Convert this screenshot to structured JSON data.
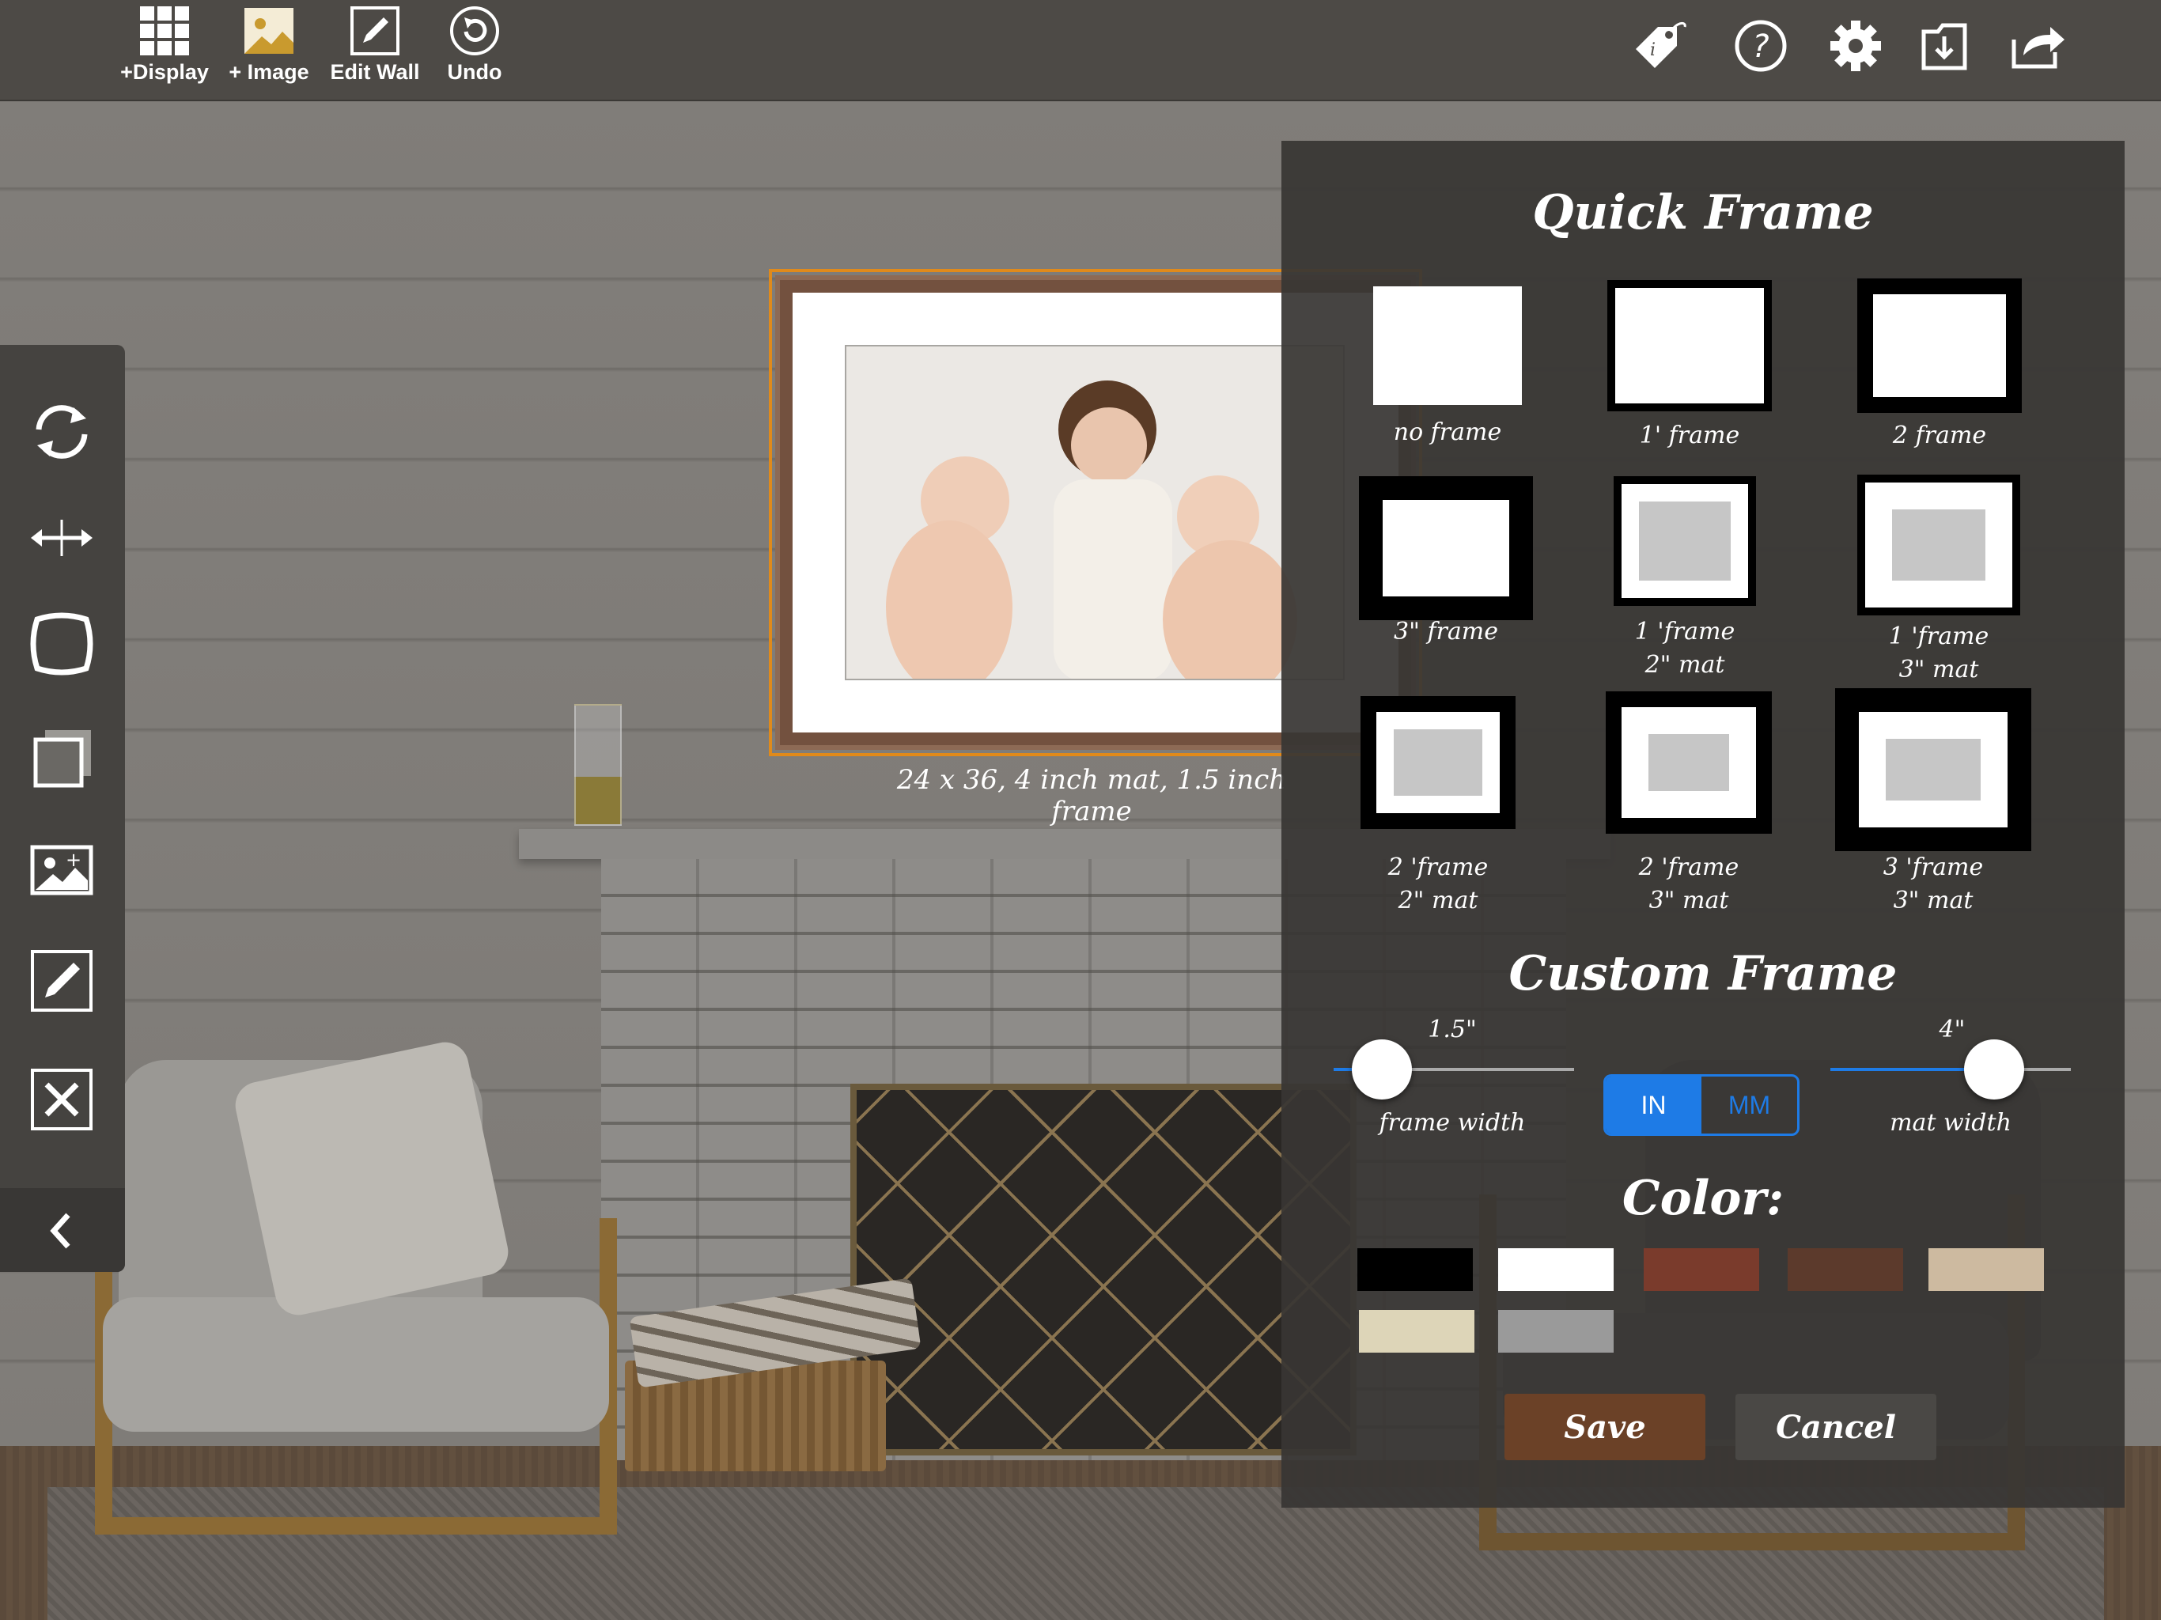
{
  "toolbar": {
    "display_label": "+Display",
    "image_label": "+ Image",
    "edit_wall_label": "Edit Wall",
    "undo_label": "Undo",
    "right_icons": [
      "info-tag-icon",
      "help-icon",
      "gear-icon",
      "save-to-folder-icon",
      "share-icon"
    ]
  },
  "rail": {
    "items": [
      "rotate-icon",
      "resize-horizontal-icon",
      "frame-style-icon",
      "shadow-icon",
      "add-image-icon",
      "edit-icon",
      "delete-icon"
    ],
    "collapse_icon": "chevron-left-icon"
  },
  "wall_display": {
    "caption": "24 x 36, 4 inch mat, 1.5 inch frame",
    "frame_color": "#73513f",
    "selection_color": "#e08a1b"
  },
  "panel": {
    "quick_frame_title": "Quick Frame",
    "quick_frames": [
      {
        "line1": "no frame",
        "line2": ""
      },
      {
        "line1": "1' frame",
        "line2": ""
      },
      {
        "line1": "2 frame",
        "line2": ""
      },
      {
        "line1": "3\" frame",
        "line2": ""
      },
      {
        "line1": "1 'frame",
        "line2": "2\" mat"
      },
      {
        "line1": "1 'frame",
        "line2": "3\" mat"
      },
      {
        "line1": "2 'frame",
        "line2": "2\" mat"
      },
      {
        "line1": "2 'frame",
        "line2": "3\" mat"
      },
      {
        "line1": "3 'frame",
        "line2": "3\" mat"
      }
    ],
    "custom_frame_title": "Custom Frame",
    "frame_width": {
      "value": "1.5\"",
      "label": "frame width",
      "fraction": 0.2
    },
    "mat_width": {
      "value": "4\"",
      "label": "mat width",
      "fraction": 0.68
    },
    "units": {
      "in": "IN",
      "mm": "MM",
      "selected": "IN"
    },
    "color_title": "Color:",
    "colors": [
      "#000000",
      "#ffffff",
      "#7a3b2c",
      "#5c3a2c",
      "#cdbaa0",
      "#ddd5b8",
      "#9a9a9a"
    ],
    "save_label": "Save",
    "cancel_label": "Cancel",
    "accent": "#1e7be6"
  }
}
